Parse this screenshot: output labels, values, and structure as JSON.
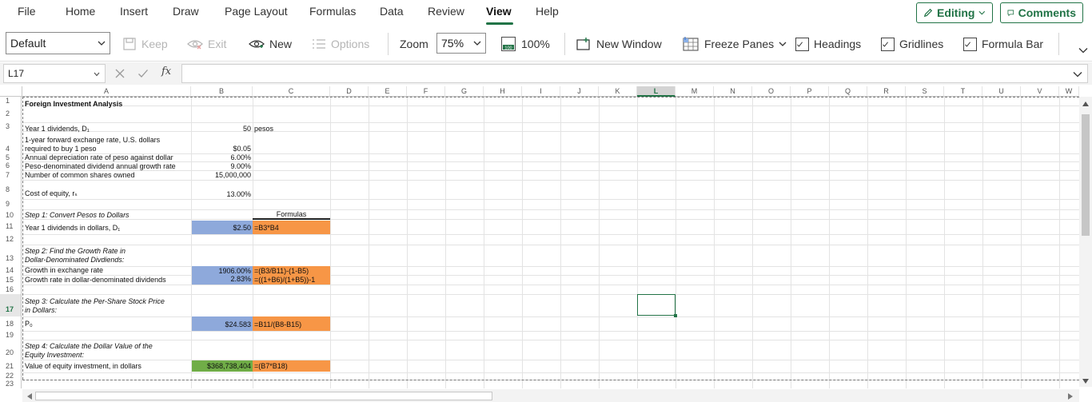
{
  "menu": {
    "tabs": [
      "File",
      "Home",
      "Insert",
      "Draw",
      "Page Layout",
      "Formulas",
      "Data",
      "Review",
      "View",
      "Help"
    ],
    "active_tab": "View",
    "editing_label": "Editing",
    "comments_label": "Comments"
  },
  "ribbon": {
    "view_select": "Default",
    "keep_label": "Keep",
    "exit_label": "Exit",
    "new_label": "New",
    "options_label": "Options",
    "zoom_label": "Zoom",
    "zoom_value": "75%",
    "zoom100_label": "100%",
    "new_window_label": "New Window",
    "freeze_panes_label": "Freeze Panes",
    "headings_label": "Headings",
    "gridlines_label": "Gridlines",
    "formula_bar_label": "Formula Bar",
    "headings_checked": true,
    "gridlines_checked": true,
    "formula_bar_checked": true
  },
  "formula_bar": {
    "name_box": "L17",
    "fx_symbol": "fx",
    "content": ""
  },
  "grid": {
    "columns": [
      "A",
      "B",
      "C",
      "D",
      "E",
      "F",
      "G",
      "H",
      "I",
      "J",
      "K",
      "L",
      "M",
      "N",
      "O",
      "P",
      "Q",
      "R",
      "S",
      "T",
      "U",
      "V",
      "W"
    ],
    "rows": [
      "1",
      "2",
      "3",
      "4",
      "5",
      "6",
      "7",
      "8",
      "9",
      "10",
      "11",
      "12",
      "13",
      "14",
      "15",
      "16",
      "17",
      "18",
      "19",
      "20",
      "21",
      "22",
      "23"
    ],
    "selected_cell": "L17",
    "cells": {
      "a1": "Foreign Investment Analysis",
      "a3": "Year 1 dividends, D₁",
      "b3": "50",
      "c3": "pesos",
      "a4_line1": "1-year forward exchange rate, U.S. dollars",
      "a4_line2": "required to buy 1 peso",
      "b4": "$0.05",
      "a5": "Annual depreciation rate of peso against dollar",
      "b5": "6.00%",
      "a6": "Peso-denominated dividend annual growth rate",
      "b6": "9.00%",
      "a7": "Number of common shares owned",
      "b7": "15,000,000",
      "a8": "Cost of equity, rₛ",
      "b8": "13.00%",
      "a10": "Step 1:  Convert Pesos to Dollars",
      "c10": "Formulas",
      "a11": "Year 1 dividends in dollars, D₁",
      "b11": "$2.50",
      "c11": "=B3*B4",
      "a13_line1": "Step 2:  Find the Growth Rate in",
      "a13_line2": "Dollar-Denominated Divdiends:",
      "a14": "Growth in exchange rate",
      "b14": "1906.00%",
      "c14": "=(B3/B11)-(1-B5)",
      "a15": "Growth rate in dollar-denominated dividends",
      "b15": "2.83%",
      "c15": "=((1+B6)/(1+B5))-1",
      "a17_line1": "Step 3:  Calculate the Per-Share Stock Price",
      "a17_line2": "in Dollars:",
      "a18": "P₀",
      "b18": "$24.583",
      "c18": "=B11/(B8-B15)",
      "a20_line1": "Step 4:  Calculate the Dollar Value of the",
      "a20_line2": "Equity Investment:",
      "a21": "Value of equity investment, in dollars",
      "b21": "$368,738,404",
      "c21": "=(B7*B18)"
    }
  },
  "colors": {
    "accent": "#217346",
    "blue_fill": "#8ea9db",
    "orange_fill": "#f79646",
    "green_fill": "#70ad47"
  },
  "icons": [
    "chevron-down-icon",
    "pencil-icon",
    "comment-icon",
    "keep-icon",
    "exit-eye-icon",
    "new-view-icon",
    "options-list-icon",
    "zoom-100-icon",
    "new-window-icon",
    "freeze-panes-icon",
    "checkbox-icon",
    "cancel-x-icon",
    "enter-check-icon",
    "fx-icon"
  ]
}
